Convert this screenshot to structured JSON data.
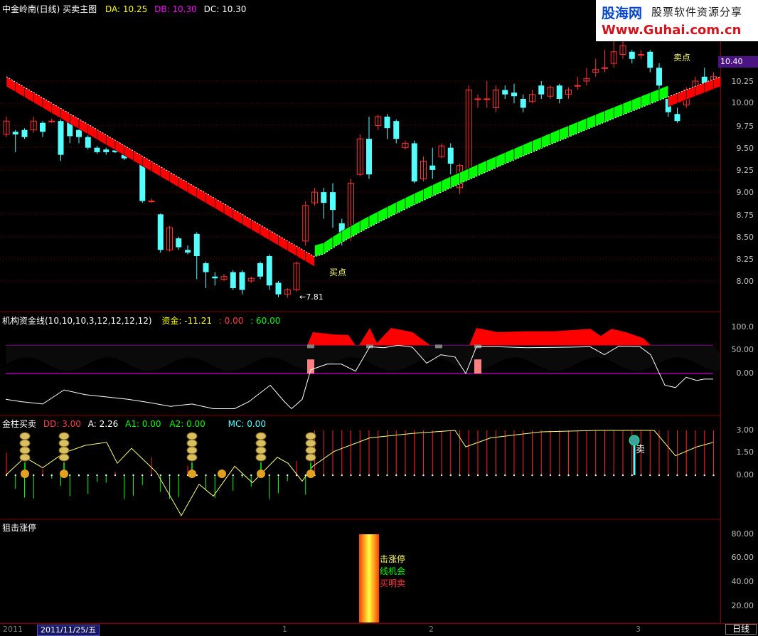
{
  "main": {
    "title": "中金岭南(日线) 买卖主图",
    "da_label": "DA: 10.25",
    "db_label": "DB: 10.30",
    "dc_label": "DC: 10.30",
    "buy_label": "买点",
    "sell_label": "卖点",
    "low_label": "←7.81",
    "current_price": "10.40",
    "axis": [
      "10.25",
      "10.00",
      "9.75",
      "9.50",
      "9.25",
      "9.00",
      "8.75",
      "8.50",
      "8.25",
      "8.00"
    ]
  },
  "logo": {
    "brand": "股海网",
    "slogan": "股票软件资源分享",
    "url": "Www.Guhai.com.cn"
  },
  "fund": {
    "title": "机构资金线(10,10,10,3,12,12,12,12)",
    "value_label": "资金: -11.21",
    "v2": ": 0.00",
    "v3": ": 60.00",
    "axis": [
      "100.0",
      "50.00",
      "0.00"
    ]
  },
  "gold": {
    "title": "金柱买卖",
    "dd": "DD: 3.00",
    "a": "A: 2.26",
    "a1": "A1: 0.00",
    "a2": "A2: 0.00",
    "mc": "MC: 0.00",
    "sell_char": "卖",
    "axis": [
      "3.00",
      "1.50",
      "0.00"
    ]
  },
  "limit": {
    "title": "狙击涨停",
    "line1": "击涨停",
    "line2": "线机会",
    "line3": "买明卖",
    "axis": [
      "80.00",
      "60.00",
      "40.00",
      "20.00"
    ]
  },
  "status": {
    "year": "2011",
    "date": "2011/11/25/五",
    "m1": "1",
    "m2": "2",
    "m3": "3",
    "period": "日线"
  },
  "colors": {
    "up": "#ff3232",
    "down": "#54ffff",
    "band_red": "#ff0000",
    "band_green": "#00ff00",
    "grid": "#800000",
    "ma_white": "#ffffff",
    "magenta": "#ff00ff"
  }
}
